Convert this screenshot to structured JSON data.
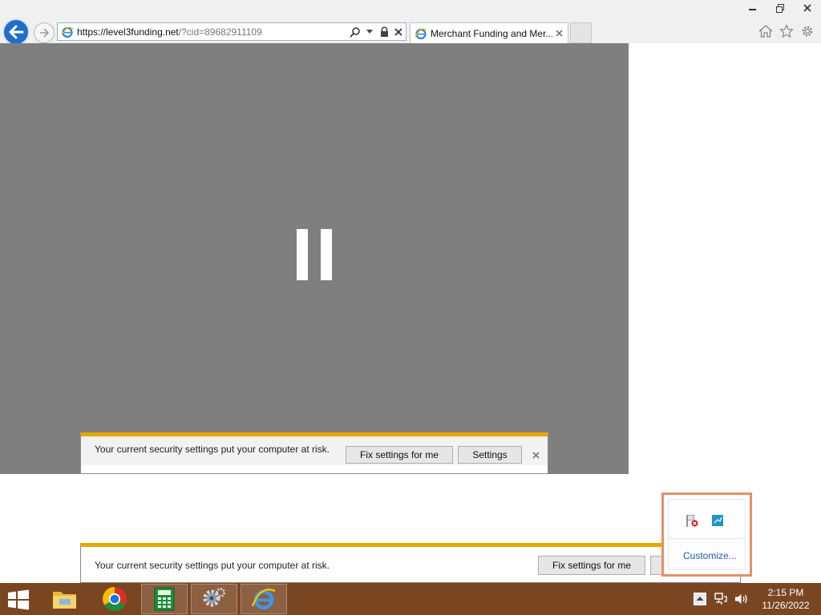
{
  "browser": {
    "address": {
      "host": "https://level3funding.net",
      "path": "/?cid=89682911109"
    },
    "tab": {
      "title": "Merchant Funding and Mer..."
    }
  },
  "page": {
    "video_state": "paused",
    "inner_security_bar": {
      "message": "Your current security settings put your computer at risk.",
      "fix_label": "Fix settings for me",
      "settings_label": "Settings"
    },
    "outer_security_bar": {
      "message": "Your current security settings put your computer at risk.",
      "fix_label": "Fix settings for me"
    }
  },
  "tray_flyout": {
    "customize_label": "Customize..."
  },
  "taskbar": {
    "apps": [
      "file-explorer",
      "chrome",
      "calculator",
      "settings",
      "internet-explorer"
    ],
    "clock": {
      "time": "2:15 PM",
      "date": "11/26/2022"
    }
  },
  "colors": {
    "taskbar": "#7a4622",
    "video_background": "#7f7f7f",
    "warning_stripe": "#e8a800",
    "highlight_border": "#e58f67",
    "ie_blue": "#1e6fc9"
  }
}
